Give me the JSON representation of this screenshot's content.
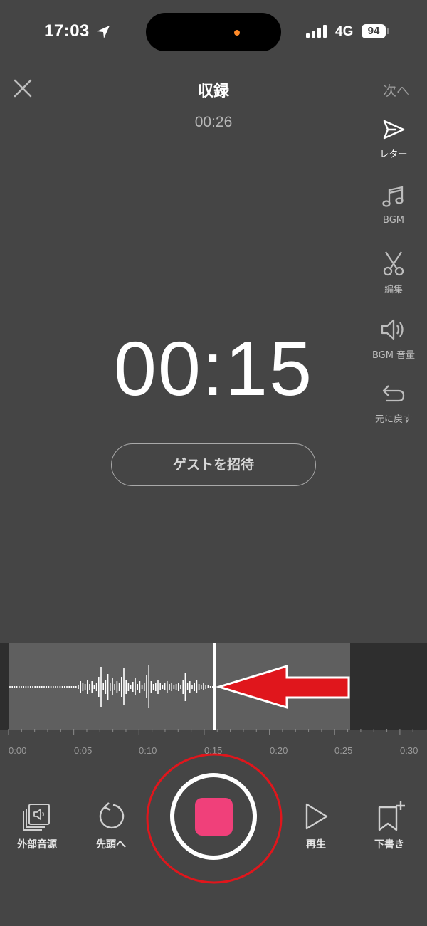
{
  "status_bar": {
    "time": "17:03",
    "network": "4G",
    "battery": "94"
  },
  "header": {
    "title": "収録",
    "next_label": "次へ",
    "total_time": "00:26"
  },
  "side_menu": [
    {
      "id": "letter",
      "label": "レター",
      "icon": "paper-plane-icon"
    },
    {
      "id": "bgm",
      "label": "BGM",
      "icon": "music-note-icon"
    },
    {
      "id": "edit",
      "label": "編集",
      "icon": "scissors-icon"
    },
    {
      "id": "bgm_volume",
      "label": "BGM 音量",
      "icon": "speaker-icon"
    },
    {
      "id": "undo",
      "label": "元に戻す",
      "icon": "undo-arrow-icon"
    }
  ],
  "recording": {
    "elapsed": "00:15",
    "invite_guest_label": "ゲストを招待"
  },
  "timeline": {
    "tick_labels": [
      "0:00",
      "0:05",
      "0:10",
      "0:15",
      "0:20",
      "0:25",
      "0:30"
    ],
    "playhead_time": "0:15"
  },
  "controls": {
    "external_audio_label": "外部音源",
    "to_start_label": "先頭へ",
    "play_label": "再生",
    "draft_label": "下書き"
  },
  "colors": {
    "background": "#454545",
    "record_stop": "#f0407a",
    "annotation_red": "#e0161c"
  }
}
